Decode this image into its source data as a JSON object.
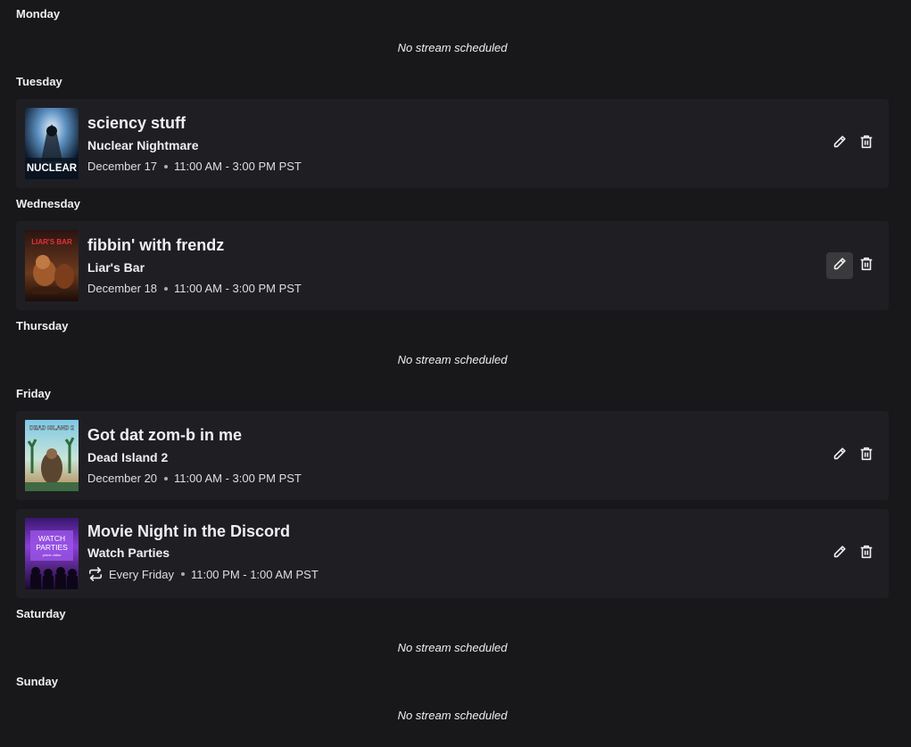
{
  "days": {
    "monday": {
      "label": "Monday",
      "empty_text": "No stream scheduled"
    },
    "tuesday": {
      "label": "Tuesday"
    },
    "wednesday": {
      "label": "Wednesday"
    },
    "thursday": {
      "label": "Thursday",
      "empty_text": "No stream scheduled"
    },
    "friday": {
      "label": "Friday"
    },
    "saturday": {
      "label": "Saturday",
      "empty_text": "No stream scheduled"
    },
    "sunday": {
      "label": "Sunday",
      "empty_text": "No stream scheduled"
    }
  },
  "segments": [
    {
      "title": "sciency stuff",
      "category": "Nuclear Nightmare",
      "date": "December 17",
      "time": "11:00 AM - 3:00 PM PST",
      "thumbnail_icon": "nuclear-nightmare-boxart",
      "thumbnail_text": "NUCLEAR"
    },
    {
      "title": "fibbin' with frendz",
      "category": "Liar's Bar",
      "date": "December 18",
      "time": "11:00 AM - 3:00 PM PST",
      "thumbnail_icon": "liars-bar-boxart",
      "thumbnail_text": "LIAR'S BAR"
    },
    {
      "title": "Got dat zom-b in me",
      "category": "Dead Island 2",
      "date": "December 20",
      "time": "11:00 AM - 3:00 PM PST",
      "thumbnail_icon": "dead-island-2-boxart",
      "thumbnail_text": "DEAD ISLAND 2"
    },
    {
      "title": "Movie Night in the Discord",
      "category": "Watch Parties",
      "date": "Every Friday",
      "time": "11:00 PM - 1:00 AM PST",
      "recurring": true,
      "thumbnail_icon": "watch-parties-boxart",
      "thumbnail_text": [
        "WATCH",
        "PARTIES",
        "prime video"
      ]
    }
  ],
  "icons": {
    "edit": "pencil-icon",
    "delete": "trash-icon",
    "repeat": "repeat-icon"
  },
  "colors": {
    "background": "#18181b",
    "card": "#1f1f23",
    "text": "#efeff1",
    "hover": "#3a3a3d"
  }
}
